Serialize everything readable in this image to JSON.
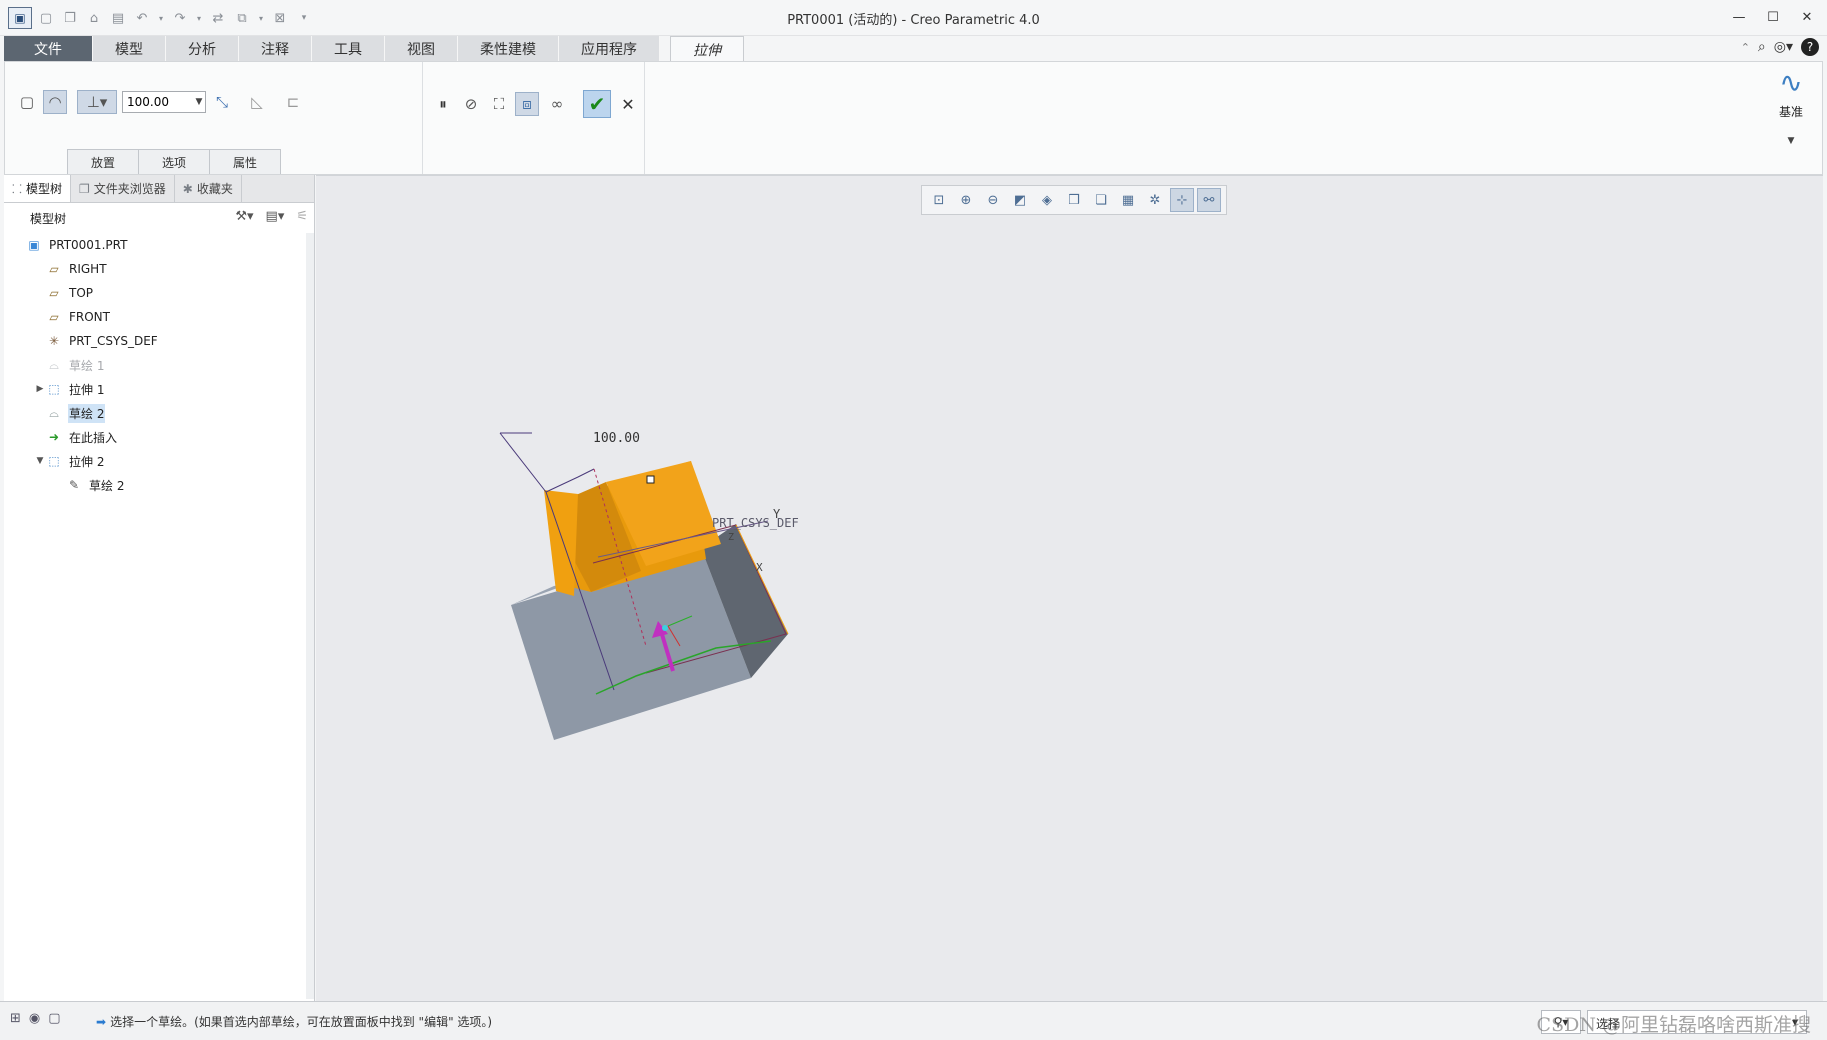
{
  "window": {
    "title": "PRT0001 (活动的) - Creo Parametric 4.0",
    "minimize": "—",
    "maximize": "☐",
    "close": "✕"
  },
  "quick_access": {
    "icons": [
      "app-menu-icon",
      "new-icon",
      "new-alt-icon",
      "open-icon",
      "save-icon",
      "undo-icon",
      "redo-icon",
      "regenerate-icon",
      "windows-icon",
      "close-window-icon",
      "customize-icon"
    ]
  },
  "ribbon_tabs": [
    {
      "label": "文件",
      "kind": "file"
    },
    {
      "label": "模型",
      "kind": "normal"
    },
    {
      "label": "分析",
      "kind": "normal"
    },
    {
      "label": "注释",
      "kind": "normal"
    },
    {
      "label": "工具",
      "kind": "normal"
    },
    {
      "label": "视图",
      "kind": "normal"
    },
    {
      "label": "柔性建模",
      "kind": "normal"
    },
    {
      "label": "应用程序",
      "kind": "normal"
    },
    {
      "label": "拉伸",
      "kind": "active"
    }
  ],
  "extrude": {
    "depth_value": "100.00",
    "subtabs": [
      "放置",
      "选项",
      "属性"
    ],
    "datum_label": "基准"
  },
  "left_panel": {
    "tabs": [
      {
        "label": "模型树",
        "icon": "model-tree-icon"
      },
      {
        "label": "文件夹浏览器",
        "icon": "folder-icon"
      },
      {
        "label": "收藏夹",
        "icon": "favorites-icon"
      }
    ],
    "tree_title": "模型树",
    "items": [
      {
        "label": "PRT0001.PRT",
        "icon": "part-icon",
        "indent": 0,
        "expander": "",
        "state": "normal"
      },
      {
        "label": "RIGHT",
        "icon": "datum-plane-icon",
        "indent": 1,
        "expander": "",
        "state": "normal"
      },
      {
        "label": "TOP",
        "icon": "datum-plane-icon",
        "indent": 1,
        "expander": "",
        "state": "normal"
      },
      {
        "label": "FRONT",
        "icon": "datum-plane-icon",
        "indent": 1,
        "expander": "",
        "state": "normal"
      },
      {
        "label": "PRT_CSYS_DEF",
        "icon": "csys-icon",
        "indent": 1,
        "expander": "",
        "state": "normal"
      },
      {
        "label": "草绘 1",
        "icon": "sketch-icon",
        "indent": 1,
        "expander": "",
        "state": "dim"
      },
      {
        "label": "拉伸 1",
        "icon": "extrude-icon",
        "indent": 1,
        "expander": "▶",
        "state": "normal"
      },
      {
        "label": "草绘 2",
        "icon": "sketch-icon",
        "indent": 1,
        "expander": "",
        "state": "selected"
      },
      {
        "label": "在此插入",
        "icon": "insert-here-icon",
        "indent": 1,
        "expander": "",
        "state": "normal"
      },
      {
        "label": "拉伸 2",
        "icon": "extrude-new-icon",
        "indent": 1,
        "expander": "▼",
        "state": "normal"
      },
      {
        "label": "草绘 2",
        "icon": "sketch-edit-icon",
        "indent": 2,
        "expander": "",
        "state": "normal"
      }
    ]
  },
  "viewport": {
    "dimension_label": "100.00",
    "csys_label": "PRT_CSYS_DEF",
    "axis_y": "Y",
    "axis_x": "X",
    "axis_z": "Z",
    "colors": {
      "orange_top": "#f0a010",
      "orange_side": "#d38a0c",
      "gray_top": "#9aa4b2",
      "gray_front": "#8e98a6",
      "gray_side": "#5f6670",
      "background": "#e9eaed"
    }
  },
  "status": {
    "message": "选择一个草绘。(如果首选内部草绘，可在放置面板中找到 \"编辑\" 选项。)",
    "filter_value": "选择",
    "watermark": "CSDN @阿里钻磊咯啥西斯准搜"
  }
}
